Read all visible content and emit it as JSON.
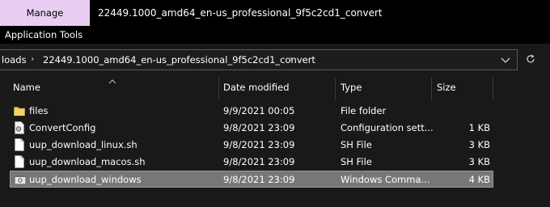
{
  "ribbon": {
    "manage_tab": "Manage",
    "window_title": "22449.1000_amd64_en-us_professional_9f5c2cd1_convert",
    "context_label": "Application Tools"
  },
  "address_bar": {
    "crumbs": [
      "loads",
      "22449.1000_amd64_en-us_professional_9f5c2cd1_convert"
    ],
    "dropdown_icon": "chevron-down-icon",
    "refresh_icon": "refresh-icon"
  },
  "columns": {
    "name": "Name",
    "date": "Date modified",
    "type": "Type",
    "size": "Size"
  },
  "files": [
    {
      "name": "files",
      "date": "9/9/2021 00:05",
      "type": "File folder",
      "size": "",
      "icon": "folder-icon"
    },
    {
      "name": "ConvertConfig",
      "date": "9/8/2021 23:09",
      "type": "Configuration sett...",
      "size": "1 KB",
      "icon": "config-file-icon"
    },
    {
      "name": "uup_download_linux.sh",
      "date": "9/8/2021 23:09",
      "type": "SH File",
      "size": "3 KB",
      "icon": "file-icon"
    },
    {
      "name": "uup_download_macos.sh",
      "date": "9/8/2021 23:09",
      "type": "SH File",
      "size": "3 KB",
      "icon": "file-icon"
    },
    {
      "name": "uup_download_windows",
      "date": "9/8/2021 23:09",
      "type": "Windows Comma...",
      "size": "4 KB",
      "icon": "script-file-icon",
      "selected": true
    }
  ],
  "colors": {
    "background": "#191919",
    "manage_tab": "#e9cdf2",
    "selected_row": "#777777",
    "folder": "#e8c25a"
  }
}
